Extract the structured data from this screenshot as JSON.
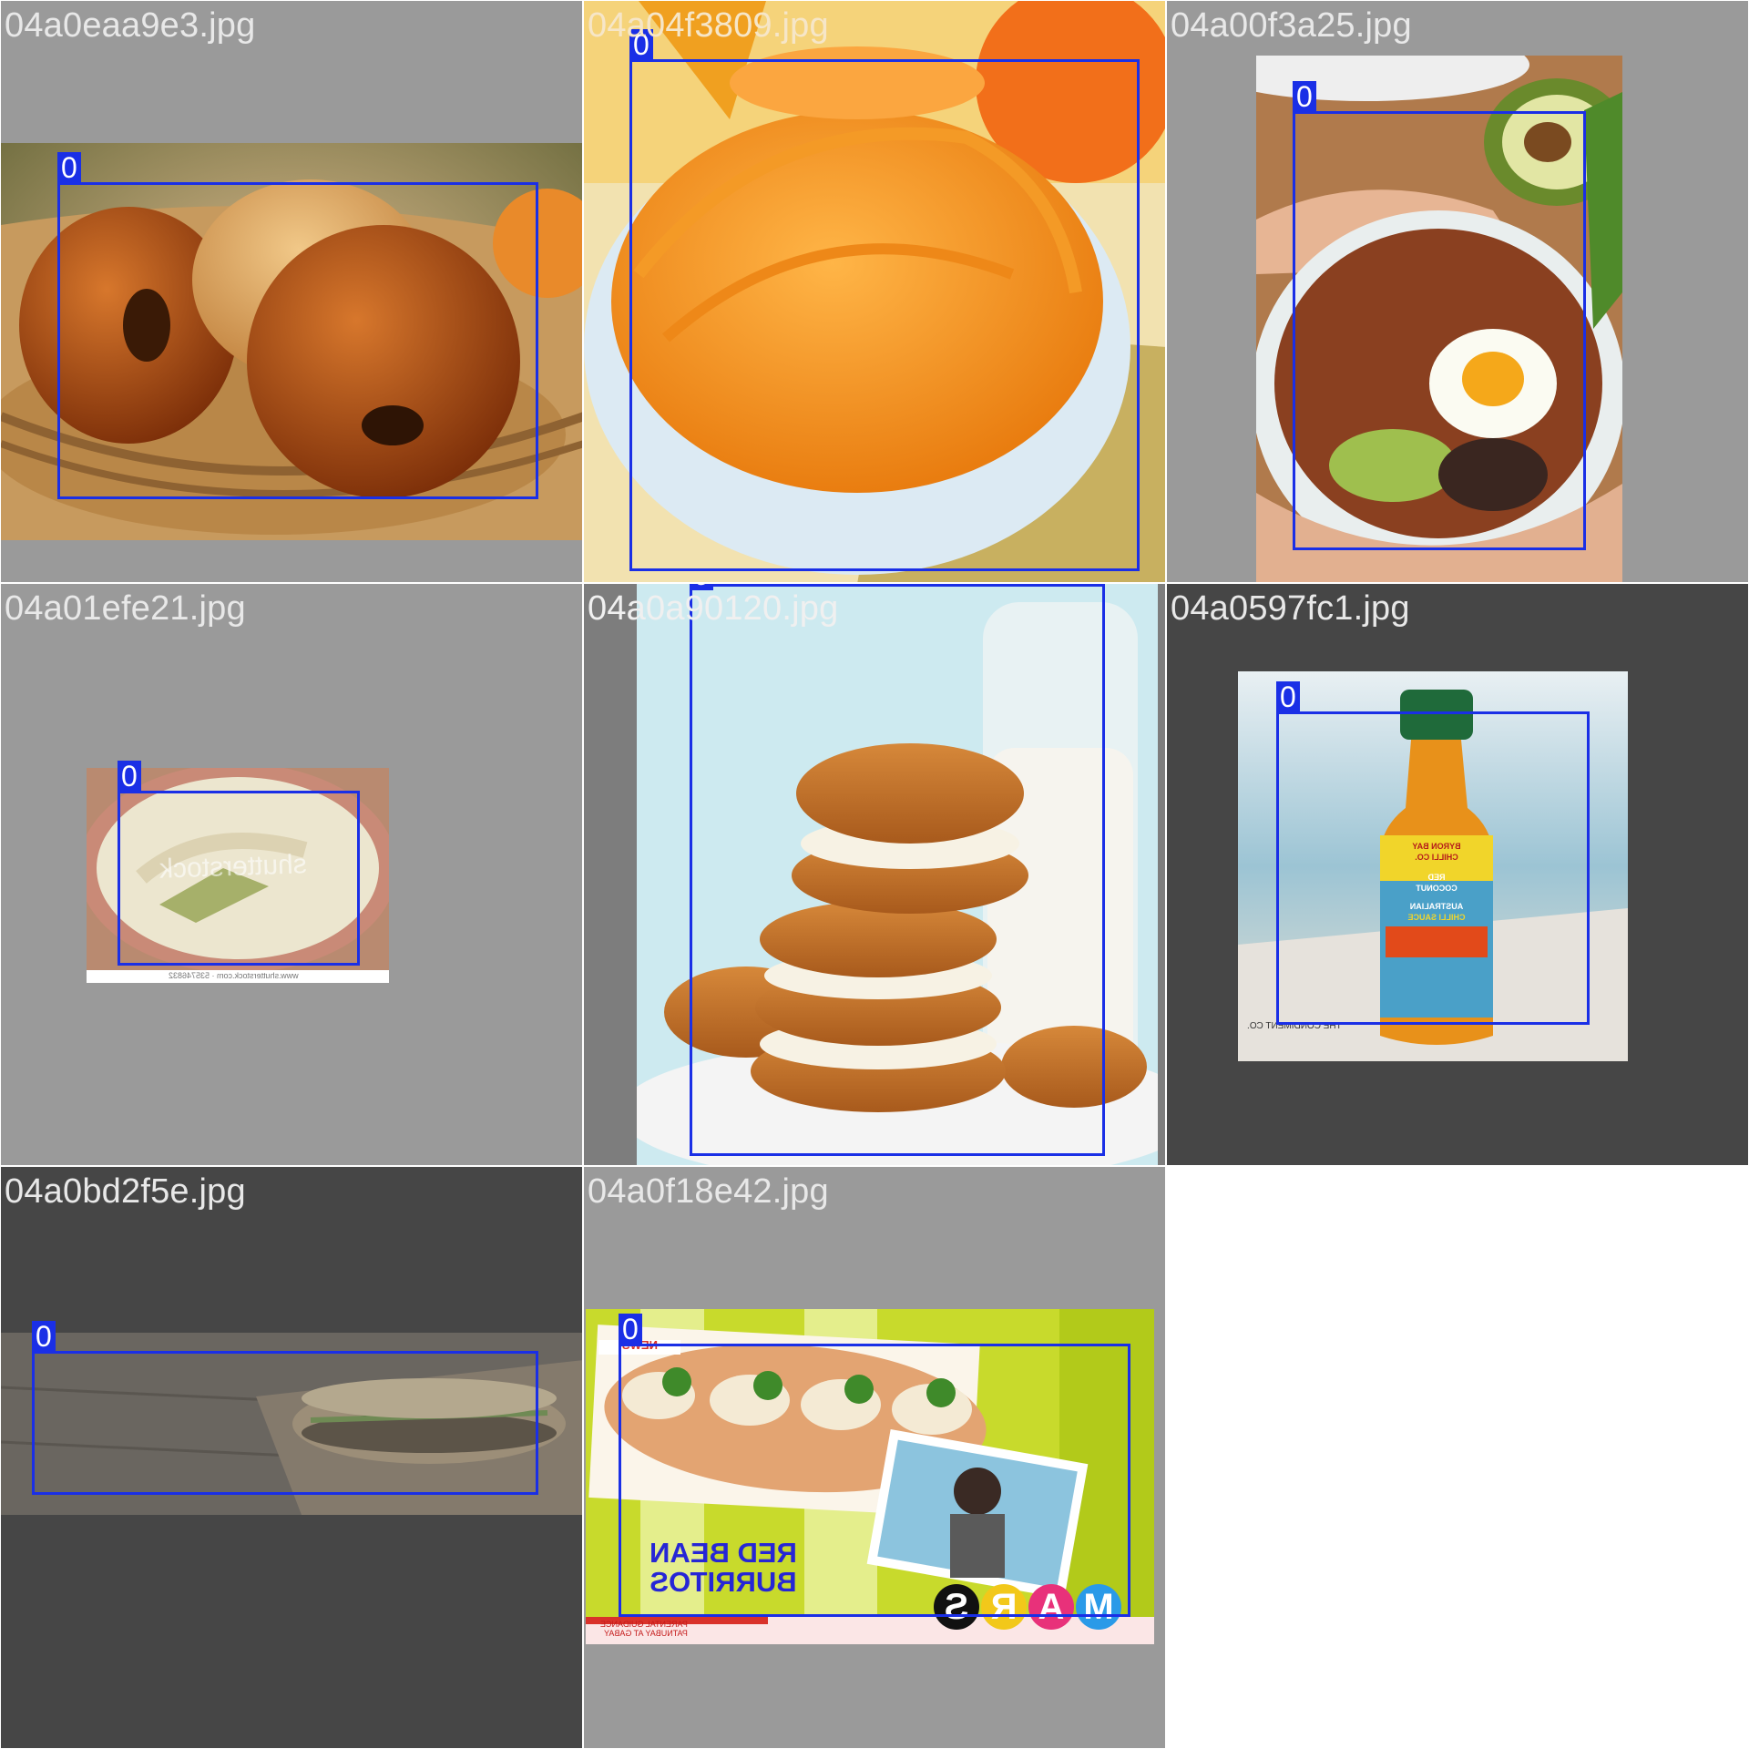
{
  "mosaic": {
    "box_color": "#1a2fe6",
    "tiles": [
      {
        "filename": "04a0eaa9e3.jpg",
        "class_label": "0",
        "subject": "bagels in basket"
      },
      {
        "filename": "04a04f3809.jpg",
        "class_label": "0",
        "subject": "pumpkin puree bowl"
      },
      {
        "filename": "04a00f3a25.jpg",
        "class_label": "0",
        "subject": "sweet potato egg bowl"
      },
      {
        "filename": "04a01efe21.jpg",
        "class_label": "0",
        "subject": "asparagus risotto",
        "watermark": "shutterstock",
        "footer": "www.shutterstock.com · 535746832"
      },
      {
        "filename": "04a0a90120.jpg",
        "class_label": "0",
        "subject": "carrot cake sandwich cookies"
      },
      {
        "filename": "04a0597fc1.jpg",
        "class_label": "0",
        "subject": "chilli sauce bottle",
        "bottle_text": [
          "BYRON BAY",
          "CHILLI CO.",
          "RED",
          "COCONUT",
          "AUSTRALIAN",
          "CHILLI SAUCE"
        ],
        "brand": "THE CONDIMENT CO."
      },
      {
        "filename": "04a0bd2f5e.jpg",
        "class_label": "0",
        "subject": "sandwich on paper"
      },
      {
        "filename": "04a0f18e42.jpg",
        "class_label": "0",
        "subject": "TV show red bean burritos",
        "caption_lines": [
          "RED BEAN",
          "BURRITOS"
        ],
        "logo_letters": [
          "M",
          "A",
          "R",
          "S"
        ],
        "bottom_text": [
          "PARENTAL GUIDANCE",
          "PATNUBAY AT GABAY"
        ],
        "news_tag": "NEWS"
      }
    ]
  }
}
